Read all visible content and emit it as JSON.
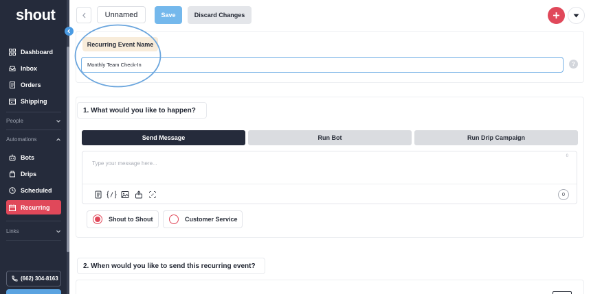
{
  "sidebar": {
    "logo": "shout",
    "items": [
      {
        "label": "Dashboard",
        "icon": "grid-icon"
      },
      {
        "label": "Inbox",
        "icon": "inbox-icon"
      },
      {
        "label": "Orders",
        "icon": "orders-icon"
      },
      {
        "label": "Shipping",
        "icon": "shipping-icon"
      }
    ],
    "sections": {
      "people": "People",
      "automations": "Automations",
      "links": "Links"
    },
    "automation_items": [
      {
        "label": "Bots",
        "icon": "bot-icon"
      },
      {
        "label": "Drips",
        "icon": "drip-icon"
      },
      {
        "label": "Scheduled",
        "icon": "clock-icon"
      },
      {
        "label": "Recurring",
        "icon": "recurring-icon",
        "active": true
      }
    ],
    "phone": "(662) 304-8163"
  },
  "toolbar": {
    "event_name_display": "Unnamed",
    "save_label": "Save",
    "discard_label": "Discard Changes"
  },
  "event_name": {
    "label": "Recurring Event Name",
    "value": "Monthly Team Check-In",
    "help": "?"
  },
  "section1": {
    "title": "1. What would you like to happen?",
    "tabs": [
      "Send Message",
      "Run Bot",
      "Run Drip Campaign"
    ],
    "active_tab": "Send Message",
    "message_placeholder": "Type your message here...",
    "char_count_top": "0",
    "char_count": "0",
    "tools": [
      "template-icon",
      "variable-icon",
      "image-icon",
      "attachment-icon",
      "link-icon"
    ],
    "channel_options": [
      {
        "label": "Shout to Shout",
        "selected": true
      },
      {
        "label": "Customer Service",
        "selected": false
      }
    ]
  },
  "section2": {
    "title": "2. When would you like to send this recurring event?"
  },
  "colors": {
    "sidebar": "#252b3b",
    "accent_red": "#e0485a",
    "accent_blue": "#74b8ec"
  }
}
